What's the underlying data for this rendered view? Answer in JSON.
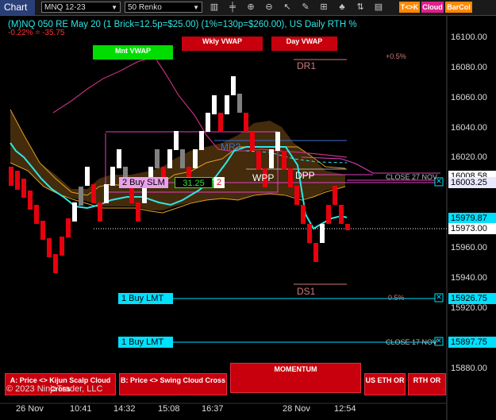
{
  "toolbar": {
    "title": "Chart",
    "instrument": "MNQ 12-23",
    "bar_type": "50 Renko",
    "buttons": {
      "tk": "T<>K",
      "cloud": "Cloud",
      "barcol": "BarCol"
    }
  },
  "header": {
    "title": "(M)NQ 050 RE May 20 (1 Brick=12.5p=$25.00) (1%=130p=$260.00), US Daily RTH %",
    "change": "-0.22% = -35.75"
  },
  "axis": {
    "prices": [
      "16100.00",
      "16080.00",
      "16060.00",
      "16040.00",
      "16020.00",
      "15960.00",
      "15940.00",
      "15920.00",
      "15880.00"
    ],
    "times": [
      "26 Nov",
      "10:41",
      "14:32",
      "15:08",
      "16:37",
      "28 Nov",
      "12:54"
    ]
  },
  "price_tags": {
    "close27": "16008.58",
    "buy_slm_price": "16003.25",
    "p15979": "15979.87",
    "last": "15973.00",
    "buy_lmt1_price": "15926.75",
    "buy_lmt2_price": "15897.75"
  },
  "levels": {
    "mnt_vwap": "Mnt VWAP",
    "wkly_vwap": "Wkly VWAP",
    "day_vwap": "Day VWAP",
    "dr1": "DR1",
    "pct_up": "+0.5%",
    "mr2": "MR2",
    "wpp": "WPP",
    "dpp": "DPP",
    "close27": "CLOSE 27 NOV",
    "ds1": "DS1",
    "pct_dn": "0.5%",
    "close17": "CLOSE 17 NOV"
  },
  "orders": {
    "buy_slm": "2 Buy SLM",
    "buy_slm_offset": "31.25",
    "buy_slm_qty": "2",
    "buy_lmt1": "1 Buy LMT",
    "buy_lmt2": "1 Buy LMT",
    "close_x": "✕"
  },
  "panel": {
    "kijun": "A: Price <> Kijun Scalp Cloud Cross",
    "swing": "B: Price <> Swing Cloud Cross",
    "momentum": "MOMENTUM",
    "us_eth": "US ETH OR",
    "rth": "RTH OR"
  },
  "copyright": "© 2023 NinjaTrader, LLC",
  "colors": {
    "up_brick": "#ffffff",
    "down_brick": "#e8000e",
    "neutral_brick": "#808080",
    "kijun": "#2ee6e6",
    "cloud": "#e0a020",
    "vwap_magenta": "#e040c0",
    "accent_cyan": "#00e0ff"
  }
}
